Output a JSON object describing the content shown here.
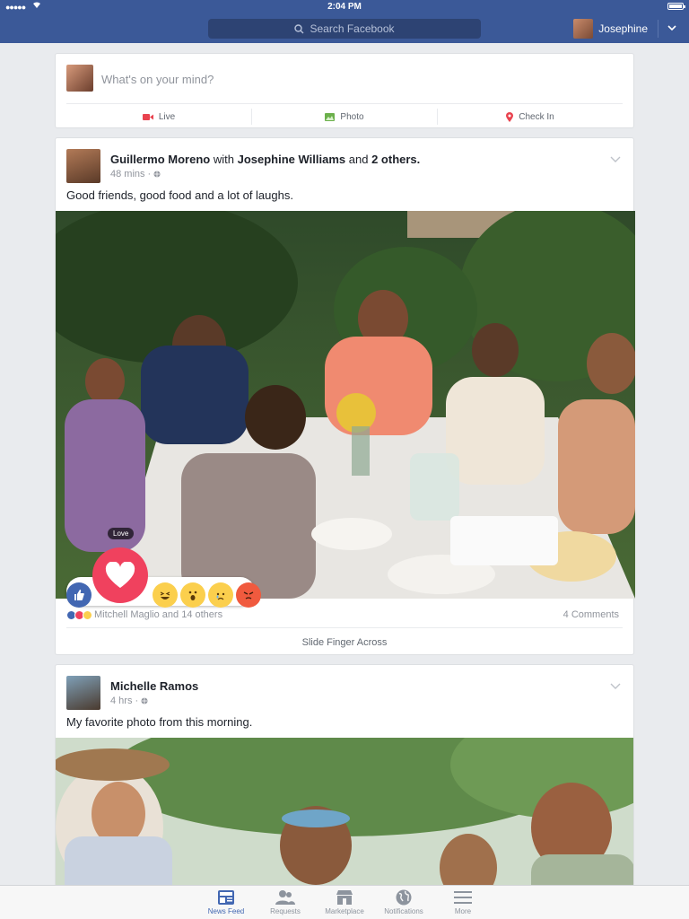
{
  "status": {
    "signal": "●●●●●",
    "time": "2:04 PM"
  },
  "nav": {
    "search_placeholder": "Search Facebook",
    "user_name": "Josephine"
  },
  "composer": {
    "prompt": "What's on your mind?",
    "actions": [
      {
        "label": "Live",
        "icon": "video-icon",
        "color": "#e9434f"
      },
      {
        "label": "Photo",
        "icon": "photo-icon",
        "color": "#6bb04b"
      },
      {
        "label": "Check In",
        "icon": "location-pin-icon",
        "color": "#e9434f"
      }
    ]
  },
  "posts": [
    {
      "author": "Guillermo Moreno",
      "with_word": "with",
      "tagged": "Josephine Williams",
      "and_word": "and",
      "others": "2 others.",
      "time": "48 mins",
      "text": "Good friends, good food and a lot of laughs.",
      "photo": "family dinner outdoors",
      "reaction_tooltip": "Love",
      "reactions": [
        "like",
        "love",
        "haha",
        "wow",
        "sad",
        "angry"
      ],
      "reaction_summary": "Mitchell Maglio and 14 others",
      "comments": "4 Comments",
      "hint": "Slide Finger Across"
    },
    {
      "author": "Michelle Ramos",
      "time": "4 hrs",
      "text": "My favorite photo from this morning.",
      "photo": "people cooking outdoors"
    }
  ],
  "tabbar": {
    "tabs": [
      {
        "label": "News Feed",
        "icon": "news-feed-icon",
        "active": true
      },
      {
        "label": "Requests",
        "icon": "friend-requests-icon",
        "active": false
      },
      {
        "label": "Marketplace",
        "icon": "marketplace-icon",
        "active": false
      },
      {
        "label": "Notifications",
        "icon": "globe-icon",
        "active": false
      },
      {
        "label": "More",
        "icon": "hamburger-menu-icon",
        "active": false
      }
    ]
  },
  "colors": {
    "brand": "#3b5998",
    "accent": "#4267b2",
    "love": "#f0415e"
  }
}
